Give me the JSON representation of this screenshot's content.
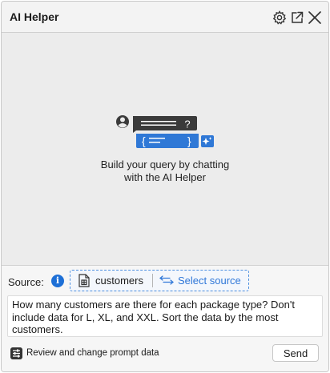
{
  "window": {
    "title": "AI Helper",
    "icons": [
      "gear-icon",
      "pop-out-icon",
      "close-icon"
    ]
  },
  "empty_state": {
    "illustration_chat_text": "?",
    "illustration_reply_text": "{",
    "illustration_reply_close": "}",
    "message_line1": "Build your query by chatting",
    "message_line2": "with the AI Helper"
  },
  "source": {
    "label": "Source:",
    "info_icon": "i",
    "selected_name": "customers",
    "select_label": "Select source"
  },
  "prompt": {
    "text": "How many customers are there for each package type? Don't include data for L, XL, and XXL. Sort the data by the most customers."
  },
  "footer": {
    "review_label": "Review and change prompt data",
    "send_label": "Send"
  },
  "colors": {
    "accent": "#2f77d8",
    "reply_bubble": "#2f78d6",
    "chat_bubble": "#3a3a3a",
    "background": "#ececec"
  }
}
